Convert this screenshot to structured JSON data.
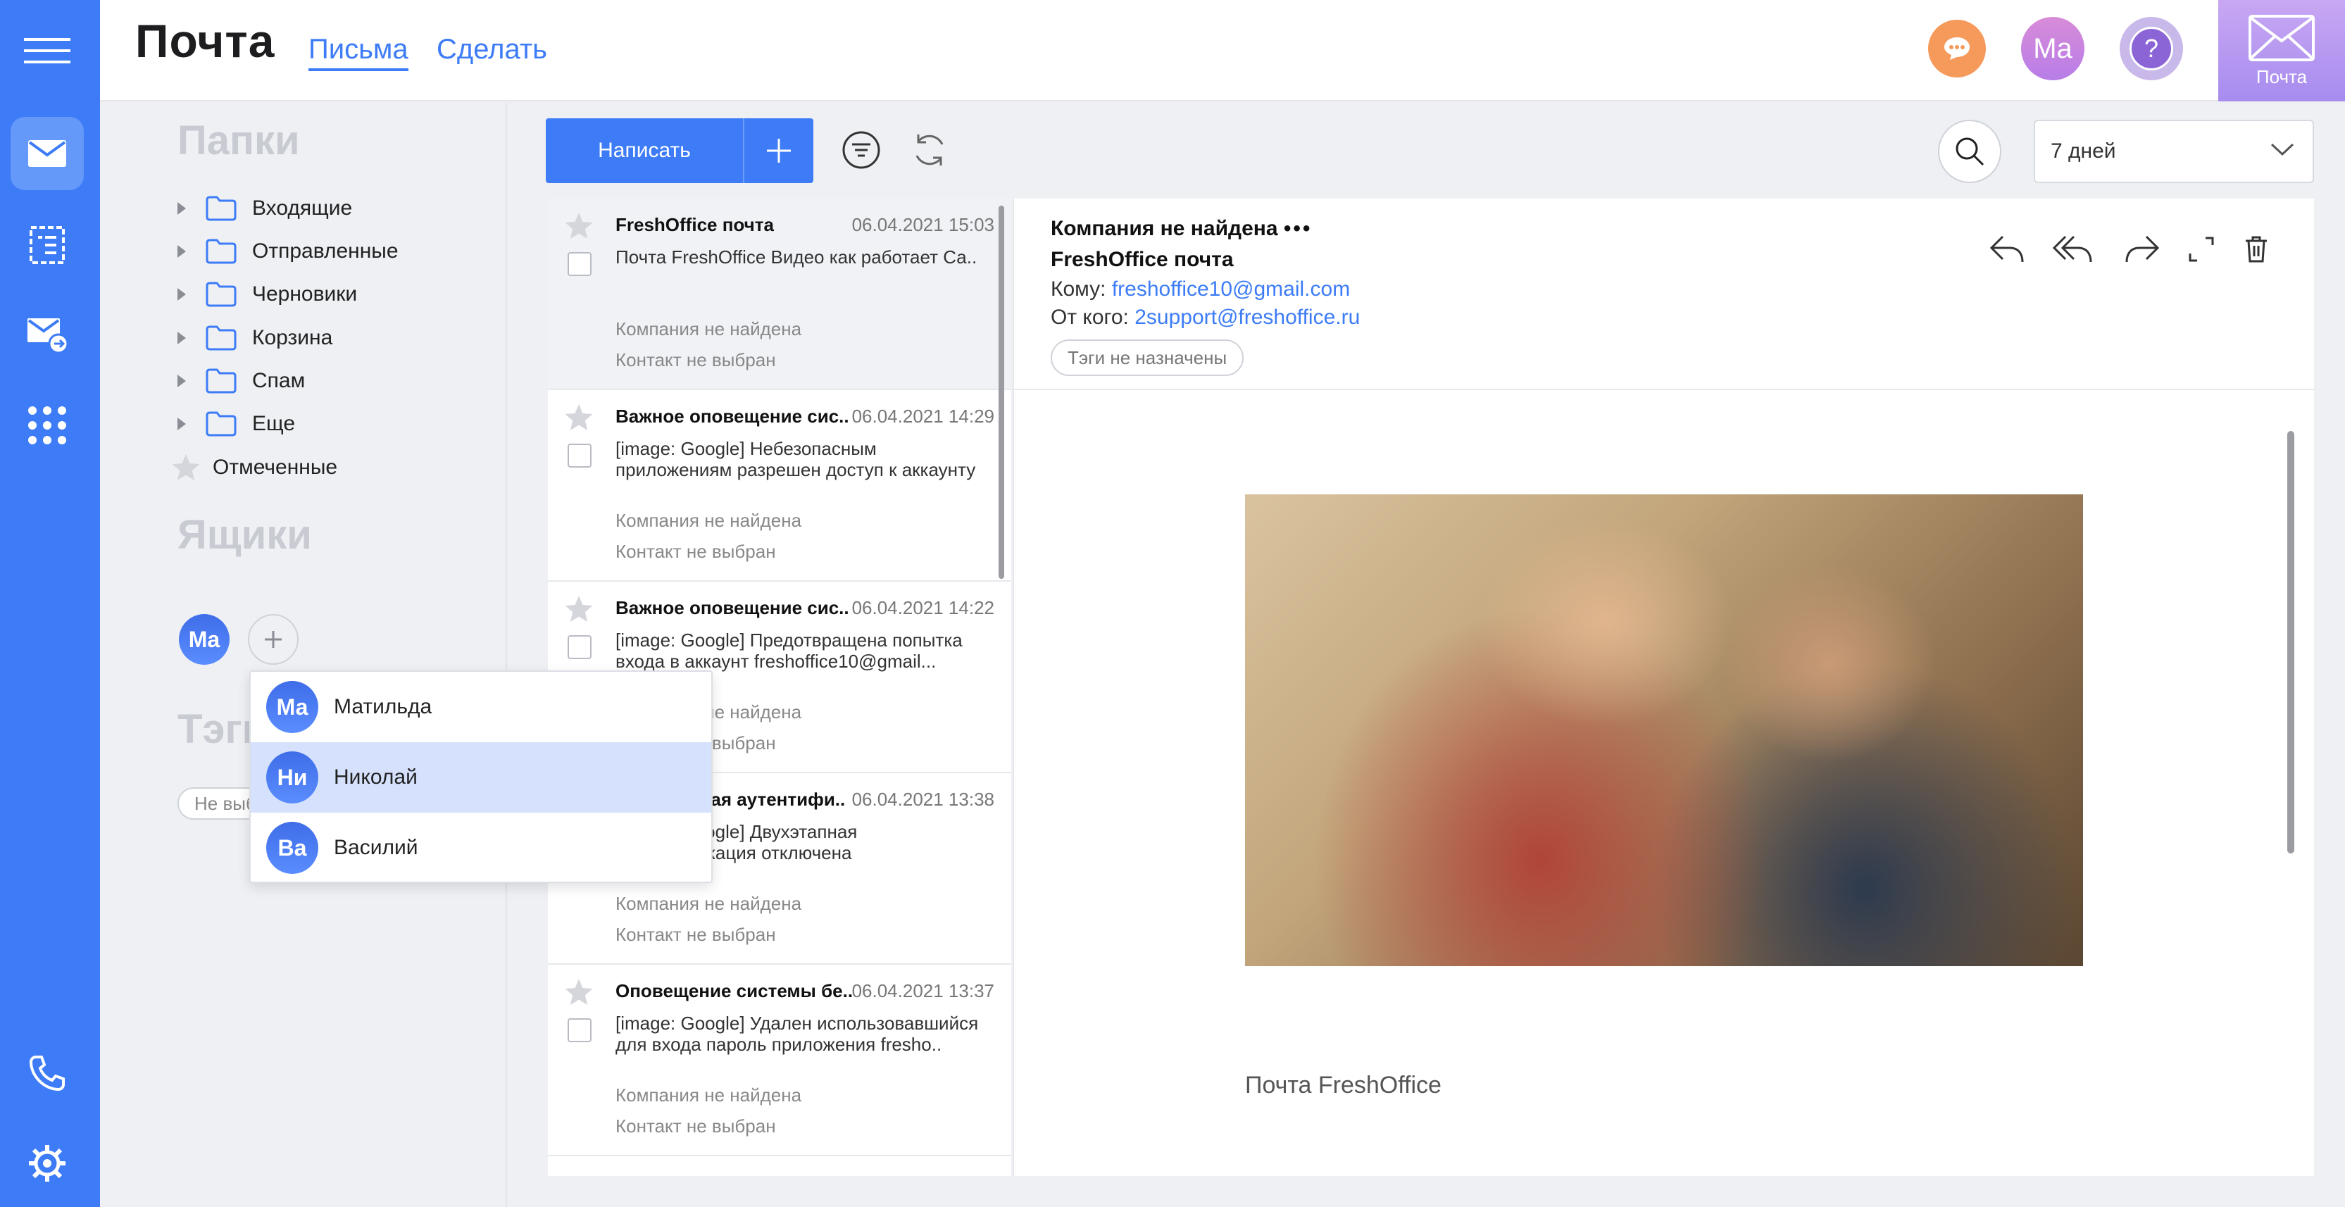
{
  "app": {
    "title": "Почта",
    "tabs": [
      {
        "label": "Письма",
        "active": true
      },
      {
        "label": "Сделать",
        "active": false
      }
    ],
    "user_initials": "Ma",
    "help_glyph": "?",
    "mail_tile_label": "Почта"
  },
  "rail": {
    "items": [
      "mail-icon",
      "tasks-icon",
      "mail-forward-icon",
      "apps-grid-icon",
      "phone-icon",
      "settings-icon"
    ],
    "accent": "#3d7cf6"
  },
  "folders": {
    "section_title": "Папки",
    "items": [
      "Входящие",
      "Отправленные",
      "Черновики",
      "Корзина",
      "Спам",
      "Еще"
    ],
    "starred": "Отмеченные",
    "boxes_title": "Ящики",
    "box_avatar": "Ma",
    "tags_title": "Тэги",
    "tag_chip": "Не выбраны"
  },
  "box_dropdown": {
    "items": [
      {
        "initials": "Ма",
        "name": "Матильда",
        "selected": false
      },
      {
        "initials": "Ни",
        "name": "Николай",
        "selected": true
      },
      {
        "initials": "Ва",
        "name": "Василий",
        "selected": false
      }
    ]
  },
  "toolbar": {
    "compose_label": "Написать",
    "period": "7 дней"
  },
  "messages": [
    {
      "from": "FreshOffice почта",
      "date": "06.04.2021 15:03",
      "preview": "Почта FreshOffice Видео как работает Са..",
      "company": "Компания не найдена",
      "contact": "Контакт не выбран",
      "selected": true
    },
    {
      "from": "Важное оповещение сис..",
      "date": "06.04.2021 14:29",
      "preview": "[image: Google] Небезопасным приложениям разрешен доступ к аккаунту",
      "company": "Компания не найдена",
      "contact": "Контакт не выбран",
      "selected": false
    },
    {
      "from": "Важное оповещение сис..",
      "date": "06.04.2021 14:22",
      "preview": "[image: Google] Предотвращена попытка входа в аккаунт freshoffice10@gmail...",
      "company": "Компания не найдена",
      "contact": "Контакт не выбран",
      "selected": false
    },
    {
      "from": "Двухэтапная аутентифи..",
      "date": "06.04.2021 13:38",
      "preview": "[image: Google] Двухэтапная аутентификация отключена",
      "company": "Компания не найдена",
      "contact": "Контакт не выбран",
      "selected": false
    },
    {
      "from": "Оповещение системы бе..",
      "date": "06.04.2021 13:37",
      "preview": "[image: Google] Удален использовавшийся для входа пароль приложения fresho..",
      "company": "Компания не найдена",
      "contact": "Контакт не выбран",
      "selected": false
    }
  ],
  "reader": {
    "company": "Компания не найдена",
    "subject": "FreshOffice почта",
    "to_label": "Кому:",
    "to_value": "freshoffice10@gmail.com",
    "from_label": "От кого:",
    "from_value": "2support@freshoffice.ru",
    "tags": "Тэги не назначены",
    "signature": "Почта FreshOffice"
  }
}
